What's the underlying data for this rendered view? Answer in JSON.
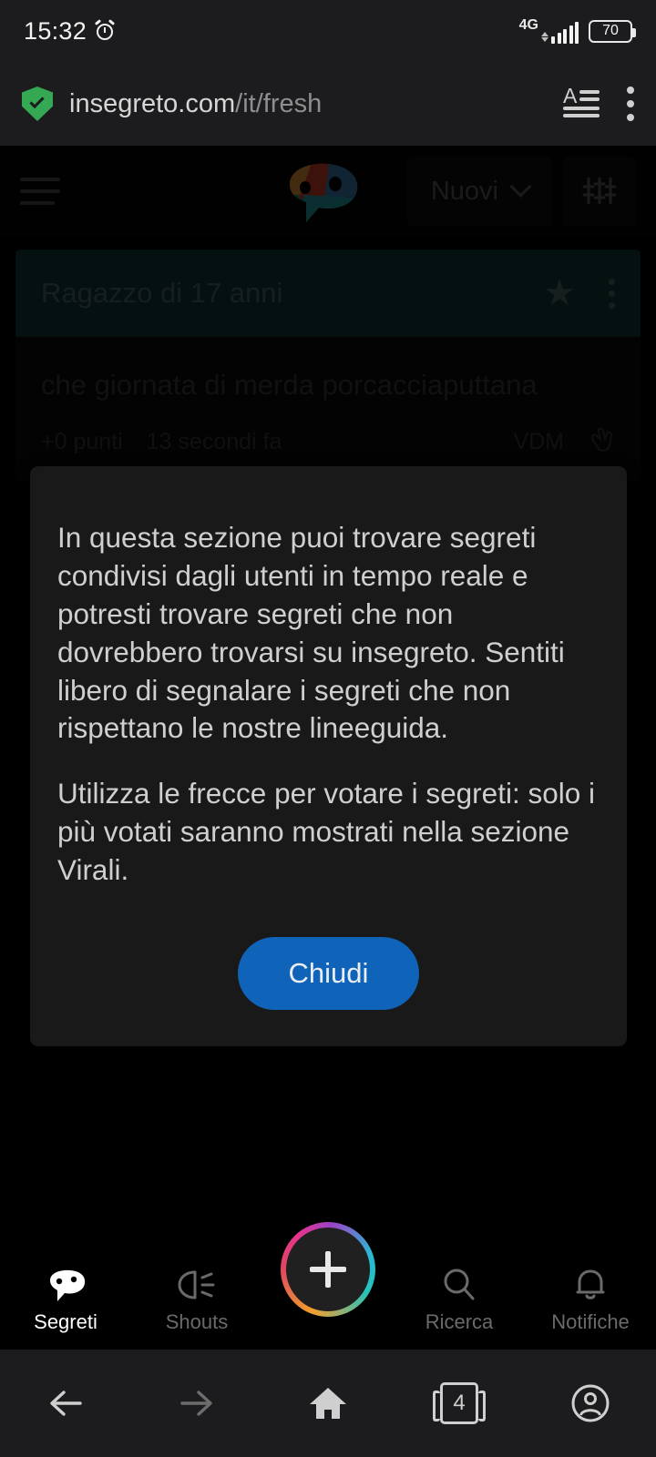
{
  "status_bar": {
    "time": "15:32",
    "alarm_icon": "alarm-icon",
    "network_type": "4G",
    "battery_level": "70"
  },
  "browser": {
    "url_domain": "insegreto.com",
    "url_path": "/it/fresh",
    "security_icon": "shield-check-icon",
    "reader_icon": "reader-mode-icon",
    "menu_icon": "overflow-menu-icon",
    "toolbar": {
      "back_label": "back-arrow-icon",
      "forward_label": "forward-arrow-icon",
      "home_label": "home-icon",
      "tabs_count": "4",
      "account_label": "account-icon"
    }
  },
  "app_header": {
    "menu_icon": "hamburger-menu-icon",
    "logo_icon": "insegreto-mask-logo",
    "sort_label": "Nuovi",
    "sort_chevron": "chevron-down-icon",
    "filter_icon": "filter-sliders-icon"
  },
  "post": {
    "author": "Ragazzo di 17 anni",
    "star_icon": "star-icon",
    "menu_icon": "post-overflow-menu-icon",
    "body": "che giornata di merda porcacciaputtana",
    "points": "+0 punti",
    "time_ago": "13 secondi fa",
    "tag": "VDM",
    "tag_icon": "hand-gesture-icon"
  },
  "dialog": {
    "paragraph_1": "In questa sezione puoi trovare segreti condivisi dagli utenti in tempo reale e potresti trovare segreti che non dovrebbero trovarsi su insegreto. Sentiti libero di segnalare i segreti che non rispettano le nostre lineeguida.",
    "paragraph_2": "Utilizza le frecce per votare i segreti: solo i più votati saranno mostrati nella sezione Virali.",
    "close_label": "Chiudi"
  },
  "bottom_nav": {
    "items": [
      {
        "label": "Segreti",
        "icon": "speech-bubble-icon",
        "active": true
      },
      {
        "label": "Shouts",
        "icon": "shout-megaphone-icon",
        "active": false
      },
      {
        "label": "Ricerca",
        "icon": "search-icon",
        "active": false
      },
      {
        "label": "Notifiche",
        "icon": "bell-icon",
        "active": false
      }
    ],
    "fab": {
      "icon": "plus-icon"
    }
  },
  "colors": {
    "accent_blue": "#0f63b8",
    "card_header_teal": "#0e2b2e",
    "shield_green": "#34a853",
    "dialog_bg": "#191919"
  }
}
